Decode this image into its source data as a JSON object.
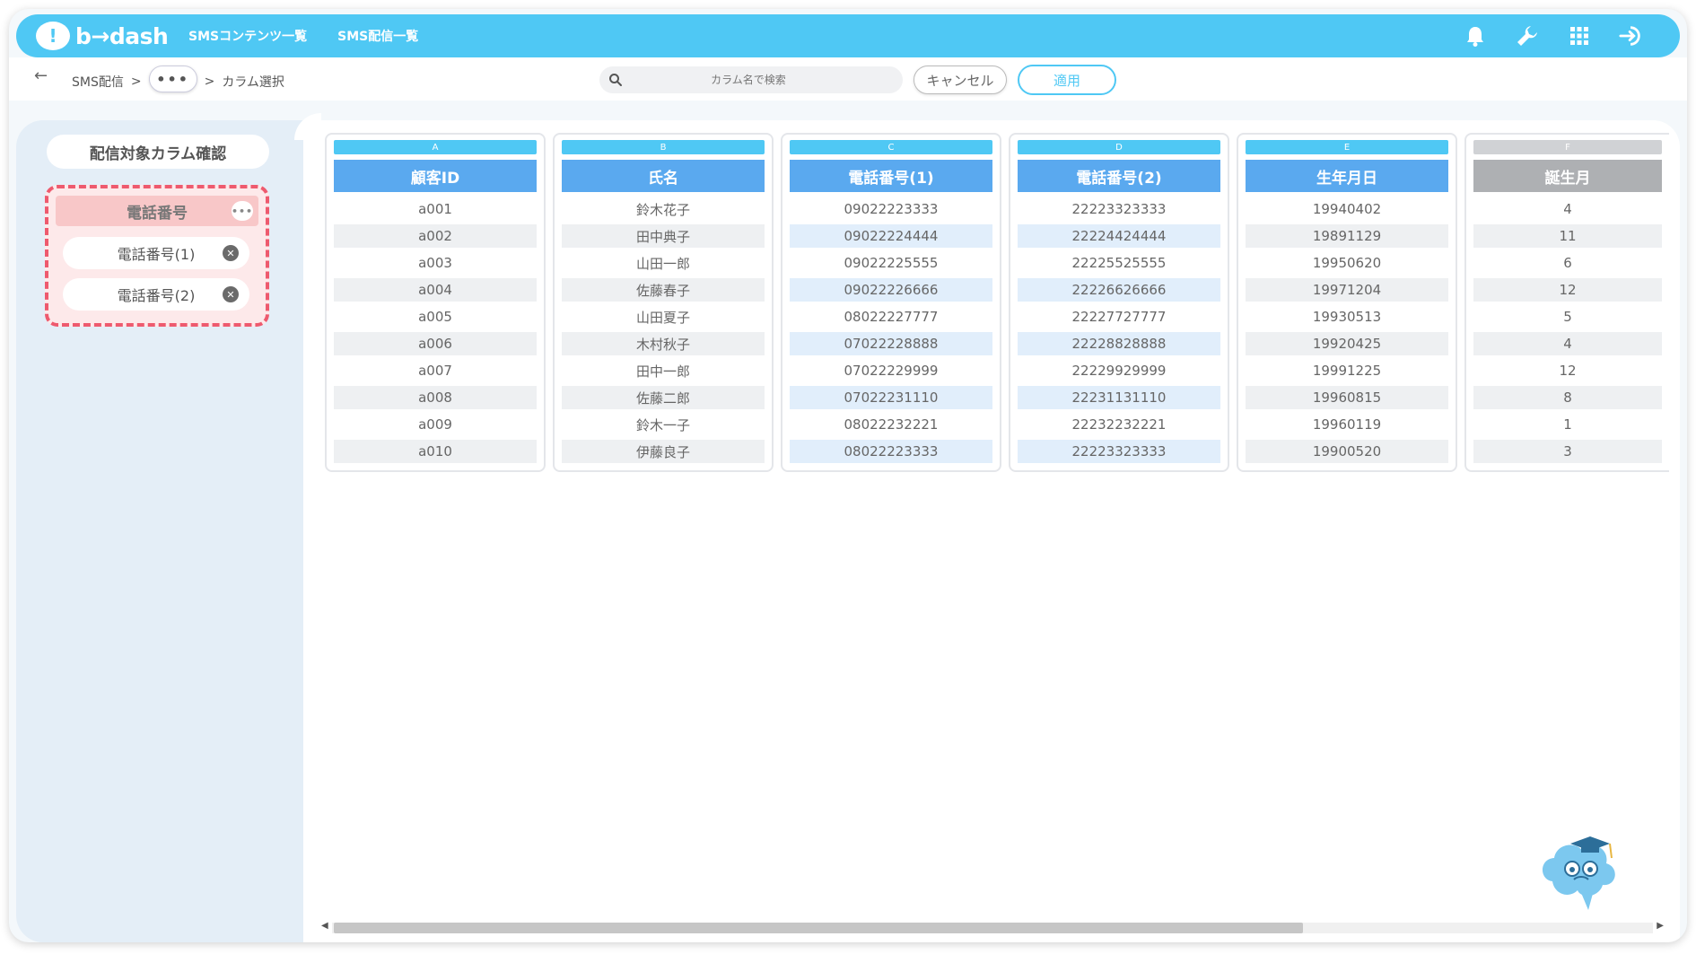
{
  "app": {
    "logo_text": "b→dash",
    "nav": [
      "SMSコンテンツ一覧",
      "SMS配信一覧"
    ]
  },
  "breadcrumb": {
    "root": "SMS配信",
    "sep": ">",
    "dots": "•••",
    "current": "カラム選択"
  },
  "search": {
    "placeholder": "カラム名で検索"
  },
  "buttons": {
    "cancel": "キャンセル",
    "apply": "適用"
  },
  "left_panel": {
    "title": "配信対象カラム確認",
    "group": {
      "name": "電話番号",
      "more": "•••",
      "columns": [
        "電話番号(1)",
        "電話番号(2)"
      ]
    }
  },
  "table": {
    "columns": [
      {
        "letter": "A",
        "header": "顧客ID",
        "values": [
          "a001",
          "a002",
          "a003",
          "a004",
          "a005",
          "a006",
          "a007",
          "a008",
          "a009",
          "a010"
        ]
      },
      {
        "letter": "B",
        "header": "氏名",
        "values": [
          "鈴木花子",
          "田中典子",
          "山田一郎",
          "佐藤春子",
          "山田夏子",
          "木村秋子",
          "田中一郎",
          "佐藤二郎",
          "鈴木一子",
          "伊藤良子"
        ]
      },
      {
        "letter": "C",
        "header": "電話番号(1)",
        "values": [
          "09022223333",
          "09022224444",
          "09022225555",
          "09022226666",
          "08022227777",
          "07022228888",
          "07022229999",
          "07022231110",
          "08022232221",
          "08022223333"
        ]
      },
      {
        "letter": "D",
        "header": "電話番号(2)",
        "values": [
          "22223323333",
          "22224424444",
          "22225525555",
          "22226626666",
          "22227727777",
          "22228828888",
          "22229929999",
          "22231131110",
          "22232232221",
          "22223323333"
        ]
      },
      {
        "letter": "E",
        "header": "生年月日",
        "values": [
          "19940402",
          "19891129",
          "19950620",
          "19971204",
          "19930513",
          "19920425",
          "19991225",
          "19960815",
          "19960119",
          "19900520"
        ]
      },
      {
        "letter": "F",
        "header": "誕生月",
        "values": [
          "4",
          "11",
          "6",
          "12",
          "5",
          "4",
          "12",
          "8",
          "1",
          "3"
        ]
      }
    ]
  },
  "colors": {
    "brand": "#4fc8f4",
    "header_blue": "#5aa9ef",
    "selected_group_border": "#ee5a6e"
  }
}
